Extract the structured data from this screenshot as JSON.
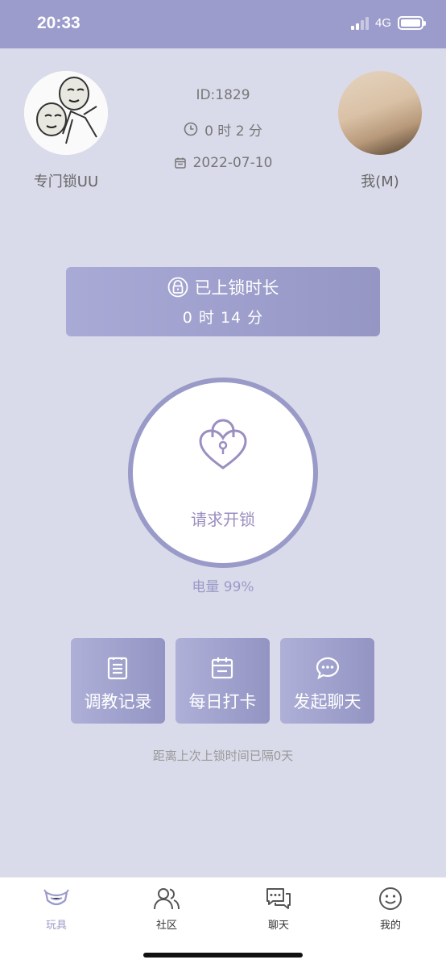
{
  "status_bar": {
    "time": "20:33",
    "network": "4G"
  },
  "profile": {
    "left_name": "专门锁UU",
    "right_name": "我(M)",
    "id": "ID:1829",
    "duration": "0 时 2 分",
    "date": "2022-07-10"
  },
  "lock_banner": {
    "title": "已上锁时长",
    "value": "0 时 14 分"
  },
  "unlock": {
    "label": "请求开锁",
    "battery": "电量 99%"
  },
  "actions": [
    {
      "label": "调教记录",
      "icon": "clipboard-icon"
    },
    {
      "label": "每日打卡",
      "icon": "calendar-icon"
    },
    {
      "label": "发起聊天",
      "icon": "chat-icon"
    }
  ],
  "footer_note": "距离上次上锁时间已隔0天",
  "tabs": [
    {
      "label": "玩具",
      "icon": "toy-icon",
      "active": true
    },
    {
      "label": "社区",
      "icon": "community-icon",
      "active": false
    },
    {
      "label": "聊天",
      "icon": "chat-bubbles-icon",
      "active": false
    },
    {
      "label": "我的",
      "icon": "smiley-icon",
      "active": false
    }
  ],
  "colors": {
    "accent": "#9a9ac8",
    "status_bar": "#9b9bcc",
    "background": "#dadbea"
  }
}
